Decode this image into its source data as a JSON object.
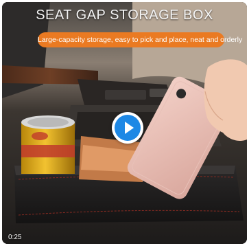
{
  "video": {
    "title": "SEAT GAP STORAGE BOX",
    "subtitle": "Large-capacity storage, easy to pick and place, neat and orderly",
    "duration": "0:25",
    "colors": {
      "banner": "#ea7a22",
      "play_icon": "#1e88e5",
      "title_text": "#f4f4f4"
    },
    "icons": {
      "play": "play-icon"
    }
  }
}
